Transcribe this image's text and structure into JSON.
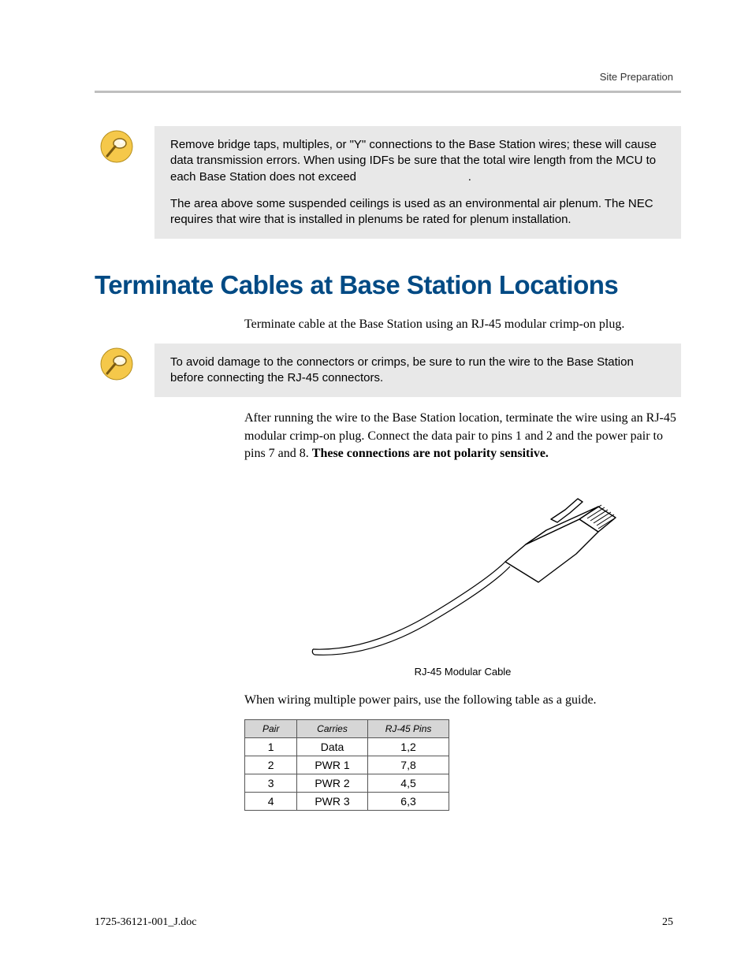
{
  "header": {
    "section": "Site Preparation"
  },
  "note1": {
    "para1": "Remove bridge taps, multiples, or \"Y\" connections to the Base Station wires; these will cause data transmission errors. When using IDFs be sure that the total wire length from the MCU to each Base Station does not exceed",
    "para1_tail": ".",
    "para2": "The area above some suspended ceilings is used as an environmental air plenum. The NEC requires that wire that is installed in plenums be rated for plenum installation."
  },
  "heading": "Terminate Cables at Base Station Locations",
  "intro": "Terminate cable at the Base Station using an RJ-45 modular crimp-on plug.",
  "note2": {
    "para1": "To avoid damage to the connectors or crimps, be sure to run the wire to the Base Station before connecting the RJ-45 connectors."
  },
  "para_after_note2_pre": "After running the wire to the Base Station location, terminate the wire using an RJ-45 modular crimp-on plug. Connect the data pair to pins 1 and 2 and the power pair to pins 7 and 8. ",
  "para_after_note2_bold": "These connections are not polarity sensitive.",
  "figure_caption": "RJ-45 Modular Cable",
  "table_intro": "When wiring multiple power pairs, use the following table as a guide.",
  "table": {
    "headers": [
      "Pair",
      "Carries",
      "RJ-45 Pins"
    ],
    "rows": [
      [
        "1",
        "Data",
        "1,2"
      ],
      [
        "2",
        "PWR 1",
        "7,8"
      ],
      [
        "3",
        "PWR 2",
        "4,5"
      ],
      [
        "4",
        "PWR 3",
        "6,3"
      ]
    ]
  },
  "footer": {
    "doc": "1725-36121-001_J.doc",
    "page": "25"
  }
}
